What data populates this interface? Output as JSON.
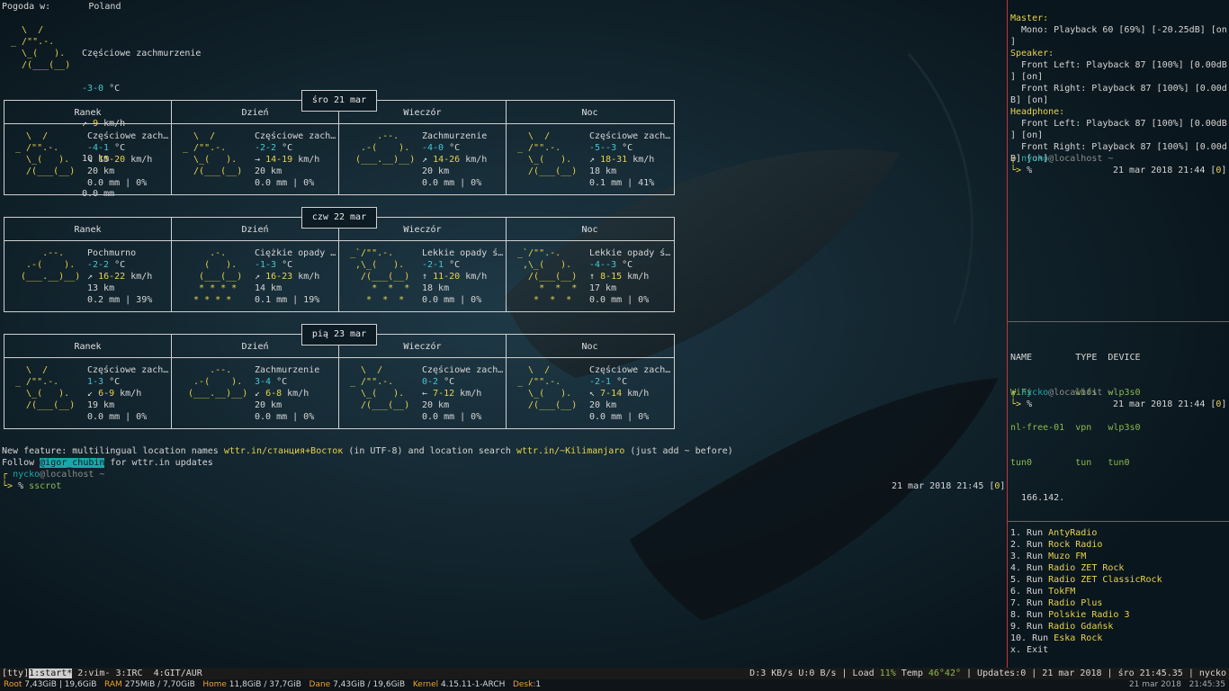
{
  "weather": {
    "header_label": "Pogoda w:",
    "location": "Poland",
    "current": {
      "art": [
        "  \\  /",
        "_ /\"\".-.",
        "  \\_(   ).",
        "  /(___(__)"
      ],
      "condition": "Częściowe zachmurzenie",
      "temp": "-3-0",
      "temp_unit": " °C",
      "wind_arrow": "↗",
      "wind": "9",
      "wind_unit": " km/h",
      "visibility": "10 km",
      "precip": "0.0 mm"
    },
    "columns": [
      "Ranek",
      "Dzień",
      "Wieczór",
      "Noc"
    ],
    "days": [
      {
        "date": "śro 21 mar",
        "slots": [
          {
            "art": [
              "  \\  /",
              "_ /\"\".-.",
              "  \\_(   ).",
              "  /(___(__)"
            ],
            "condition": "Częściowe zach…",
            "temp": "-4-1",
            "temp_unit": " °C",
            "wind_arrow": "↘",
            "wind": "15-20",
            "wind_unit": " km/h",
            "vis": "20 km",
            "precip": "0.0 mm | 0%"
          },
          {
            "art": [
              "  \\  /",
              "_ /\"\".-.",
              "  \\_(   ).",
              "  /(___(__)"
            ],
            "condition": "Częściowe zach…",
            "temp": "-2-2",
            "temp_unit": " °C",
            "wind_arrow": "→",
            "wind": "14-19",
            "wind_unit": " km/h",
            "vis": "20 km",
            "precip": "0.0 mm | 0%"
          },
          {
            "art": [
              "",
              "     .--.",
              "  .-(    ).",
              " (___.__)__)"
            ],
            "condition": "Zachmurzenie",
            "temp": "-4-0",
            "temp_unit": " °C",
            "wind_arrow": "↗",
            "wind": "14-26",
            "wind_unit": " km/h",
            "vis": "20 km",
            "precip": "0.0 mm | 0%"
          },
          {
            "art": [
              "  \\  /",
              "_ /\"\".-.",
              "  \\_(   ).",
              "  /(___(__)"
            ],
            "condition": "Częściowe zach…",
            "temp": "-5--3",
            "temp_unit": " °C",
            "wind_arrow": "↗",
            "wind": "18-31",
            "wind_unit": " km/h",
            "vis": "18 km",
            "precip": "0.1 mm | 41%"
          }
        ]
      },
      {
        "date": "czw 22 mar",
        "slots": [
          {
            "art": [
              "",
              "     .--.",
              "  .-(    ).",
              " (___.__)__)"
            ],
            "condition": "Pochmurno",
            "temp": "-2-2",
            "temp_unit": " °C",
            "wind_arrow": "↗",
            "wind": "16-22",
            "wind_unit": " km/h",
            "vis": "13 km",
            "precip": "0.2 mm | 39%"
          },
          {
            "art": [
              "     .-.",
              "    (   ).",
              "   (___(__)",
              "   * * * *",
              "  * * * *"
            ],
            "condition": "Ciężkie opady …",
            "temp": "-1-3",
            "temp_unit": " °C",
            "wind_arrow": "↗",
            "wind": "16-23",
            "wind_unit": " km/h",
            "vis": "14 km",
            "precip": "0.1 mm | 19%"
          },
          {
            "art": [
              "_`/\"\".-.",
              " ,\\_(   ).",
              "  /(___(__)",
              "    *  *  *",
              "   *  *  *"
            ],
            "condition": "Lekkie opady ś…",
            "temp": "-2-1",
            "temp_unit": " °C",
            "wind_arrow": "↑",
            "wind": "11-20",
            "wind_unit": " km/h",
            "vis": "18 km",
            "precip": "0.0 mm | 0%"
          },
          {
            "art": [
              "_`/\"\".-.",
              " ,\\_(   ).",
              "  /(___(__)",
              "    *  *  *",
              "   *  *  *"
            ],
            "condition": "Lekkie opady ś…",
            "temp": "-4--3",
            "temp_unit": " °C",
            "wind_arrow": "↑",
            "wind": "8-15",
            "wind_unit": " km/h",
            "vis": "17 km",
            "precip": "0.0 mm | 0%"
          }
        ]
      },
      {
        "date": "pią 23 mar",
        "slots": [
          {
            "art": [
              "  \\  /",
              "_ /\"\".-.",
              "  \\_(   ).",
              "  /(___(__)"
            ],
            "condition": "Częściowe zach…",
            "temp": "1-3",
            "temp_unit": " °C",
            "wind_arrow": "↙",
            "wind": "6-9",
            "wind_unit": " km/h",
            "vis": "19 km",
            "precip": "0.0 mm | 0%"
          },
          {
            "art": [
              "",
              "     .--.",
              "  .-(    ).",
              " (___.__)__)"
            ],
            "condition": "Zachmurzenie",
            "temp": "3-4",
            "temp_unit": " °C",
            "wind_arrow": "↙",
            "wind": "6-8",
            "wind_unit": " km/h",
            "vis": "20 km",
            "precip": "0.0 mm | 0%"
          },
          {
            "art": [
              "  \\  /",
              "_ /\"\".-.",
              "  \\_(   ).",
              "  /(___(__)"
            ],
            "condition": "Częściowe zach…",
            "temp": "0-2",
            "temp_unit": " °C",
            "wind_arrow": "←",
            "wind": "7-12",
            "wind_unit": " km/h",
            "vis": "20 km",
            "precip": "0.0 mm | 0%"
          },
          {
            "art": [
              "  \\  /",
              "_ /\"\".-.",
              "  \\_(   ).",
              "  /(___(__)"
            ],
            "condition": "Częściowe zach…",
            "temp": "-2-1",
            "temp_unit": " °C",
            "wind_arrow": "↖",
            "wind": "7-14",
            "wind_unit": " km/h",
            "vis": "20 km",
            "precip": "0.0 mm | 0%"
          }
        ]
      }
    ],
    "feature_line": {
      "a": "New feature: multilingual location names ",
      "link1": "wttr.in/станция+Восток",
      "b": " (in UTF-8) and location search ",
      "link2": "wttr.in/~Kilimanjaro",
      "c": " (just add ~ before)"
    },
    "follow_line": {
      "a": "Follow ",
      "handle": "@igor_chubin",
      "b": " for wttr.in updates"
    }
  },
  "prompt_main": {
    "user": "nycko",
    "host": "@localhost",
    "dir": " ~",
    "command": "sscrot",
    "timestamp": "21 mar 2018 21:45 [",
    "code": "0",
    "close": "]"
  },
  "alsa": {
    "master_label": "Master:",
    "master_line1": "  Mono: Playback 60 [69%] [-20.25dB] [on",
    "master_line2": "]",
    "speaker_label": "Speaker:",
    "speaker_l1": "  Front Left: Playback 87 [100%] [0.00dB",
    "speaker_l2": "] [on]",
    "speaker_r1": "  Front Right: Playback 87 [100%] [0.00d",
    "speaker_r2": "B] [on]",
    "headphone_label": "Headphone:",
    "head_l1": "  Front Left: Playback 87 [100%] [0.00dB",
    "head_l2": "] [on]",
    "head_r1": "  Front Right: Playback 87 [100%] [0.00d",
    "head_r2": "B] [on]",
    "prompt_user": "nycko",
    "prompt_host": "@localhost",
    "prompt_dir": " ~",
    "prompt_time": "21 mar 2018 21:44 [",
    "prompt_code": "0",
    "prompt_close": "]"
  },
  "network": {
    "headers": [
      "NAME",
      "TYPE",
      "DEVICE"
    ],
    "rows": [
      [
        "WiFi",
        "wifi",
        "wlp3s0"
      ],
      [
        "nl-free-01",
        "vpn",
        "wlp3s0"
      ],
      [
        "tun0",
        "tun",
        "tun0"
      ]
    ],
    "ip": "166.142.",
    "prompt_user": "nycko",
    "prompt_host": "@localhost",
    "prompt_dir": " ~",
    "prompt_time": "21 mar 2018 21:44 [",
    "prompt_code": "0",
    "prompt_close": "]"
  },
  "radio_menu": {
    "items": [
      {
        "num": "1. Run ",
        "name": "AntyRadio"
      },
      {
        "num": "2. Run ",
        "name": "Rock Radio"
      },
      {
        "num": "3. Run ",
        "name": "Muzo FM"
      },
      {
        "num": "4. Run ",
        "name": "Radio ZET Rock"
      },
      {
        "num": "5. Run ",
        "name": "Radio ZET ClassicRock"
      },
      {
        "num": "6. Run ",
        "name": "TokFM"
      },
      {
        "num": "7. Run ",
        "name": "Radio Plus"
      },
      {
        "num": "8. Run ",
        "name": "Polskie Radio 3"
      },
      {
        "num": "9. Run ",
        "name": "Radio Gdańsk"
      },
      {
        "num": "10. Run ",
        "name": "Eska Rock"
      }
    ],
    "exit": "x. Exit"
  },
  "statusbar": {
    "tty": "[tty]",
    "windows": [
      {
        "label": "1:start*",
        "active": true
      },
      {
        "label": " 2:vim-",
        "active": false
      },
      {
        "label": " 3:IRC",
        "active": false
      },
      {
        "label": "  4:GIT/AUR",
        "active": false
      }
    ],
    "net": "D:3 KB/s U:0 B/s",
    "load_label": " | Load ",
    "load": "11%",
    "temp_label": " Temp ",
    "temp": "46°42°",
    "updates": " | Updates:0 | 21 mar 2018 | śro 21:45.35 | nycko"
  },
  "diskbar": {
    "items": [
      {
        "label": "Root",
        "value": "7,43GiB | 19,6GiB"
      },
      {
        "label": "RAM",
        "value": "275MiB / 7,70GiB"
      },
      {
        "label": "Home",
        "value": "11,8GiB / 37,7GiB"
      },
      {
        "label": "Dane",
        "value": "7,43GiB / 19,6GiB"
      },
      {
        "label": "Kernel",
        "value": "4.15.11-1-ARCH"
      },
      {
        "label": "Desk:",
        "value": "1"
      }
    ],
    "date": "21 mar 2018",
    "time": "21:45:35"
  },
  "colors": {
    "background": "#0c1b24",
    "separator": "#c8323a",
    "accent_yellow": "#e8d34b",
    "accent_cyan": "#44c7d0",
    "accent_orange": "#f0a12a",
    "accent_green": "#8cb84d"
  }
}
